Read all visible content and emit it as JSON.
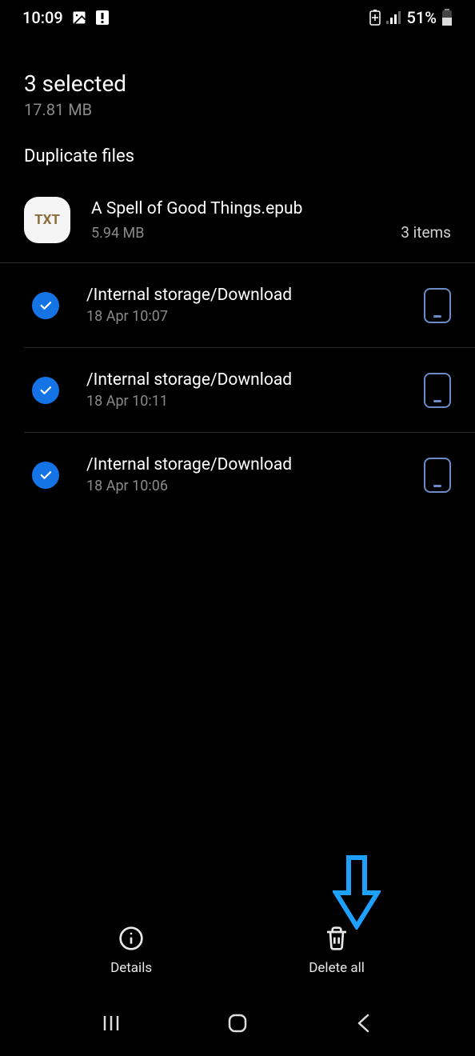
{
  "status_bar": {
    "time": "10:09",
    "battery_pct": "51%"
  },
  "header": {
    "title": "3 selected",
    "size": "17.81 MB"
  },
  "section": {
    "title": "Duplicate files"
  },
  "group": {
    "badge": "TXT",
    "name": "A Spell of Good Things.epub",
    "size": "5.94 MB",
    "count": "3 items"
  },
  "files": [
    {
      "path": "/Internal storage/Download",
      "date": "18 Apr 10:07"
    },
    {
      "path": "/Internal storage/Download",
      "date": "18 Apr 10:11"
    },
    {
      "path": "/Internal storage/Download",
      "date": "18 Apr 10:06"
    }
  ],
  "actions": {
    "details": "Details",
    "delete_all": "Delete all"
  }
}
